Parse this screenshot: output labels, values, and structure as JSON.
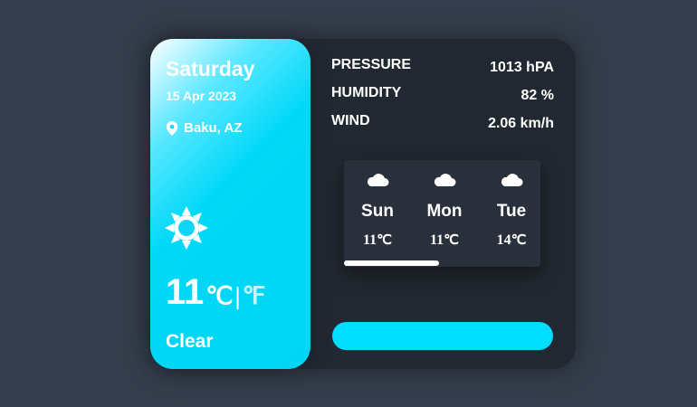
{
  "left_panel": {
    "day": "Saturday",
    "date": "15 Apr 2023",
    "location": "Baku, AZ",
    "weather_icon": "sun-icon",
    "temperature": "11",
    "unit_c": "℃",
    "unit_sep": "|",
    "unit_f": "℉",
    "description": "Clear"
  },
  "stats": [
    {
      "label": "PRESSURE",
      "value": "1013 hPA"
    },
    {
      "label": "HUMIDITY",
      "value": "82 %"
    },
    {
      "label": "WIND",
      "value": "2.06 km/h"
    }
  ],
  "forecast": [
    {
      "day": "Sun",
      "temp": "11",
      "unit": "℃",
      "icon": "cloud-icon"
    },
    {
      "day": "Mon",
      "temp": "11",
      "unit": "℃",
      "icon": "cloud-icon"
    },
    {
      "day": "Tue",
      "temp": "14",
      "unit": "℃",
      "icon": "cloud-icon"
    }
  ],
  "colors": {
    "background": "#343d4b",
    "card": "#222831",
    "accent": "#00d8f8"
  }
}
